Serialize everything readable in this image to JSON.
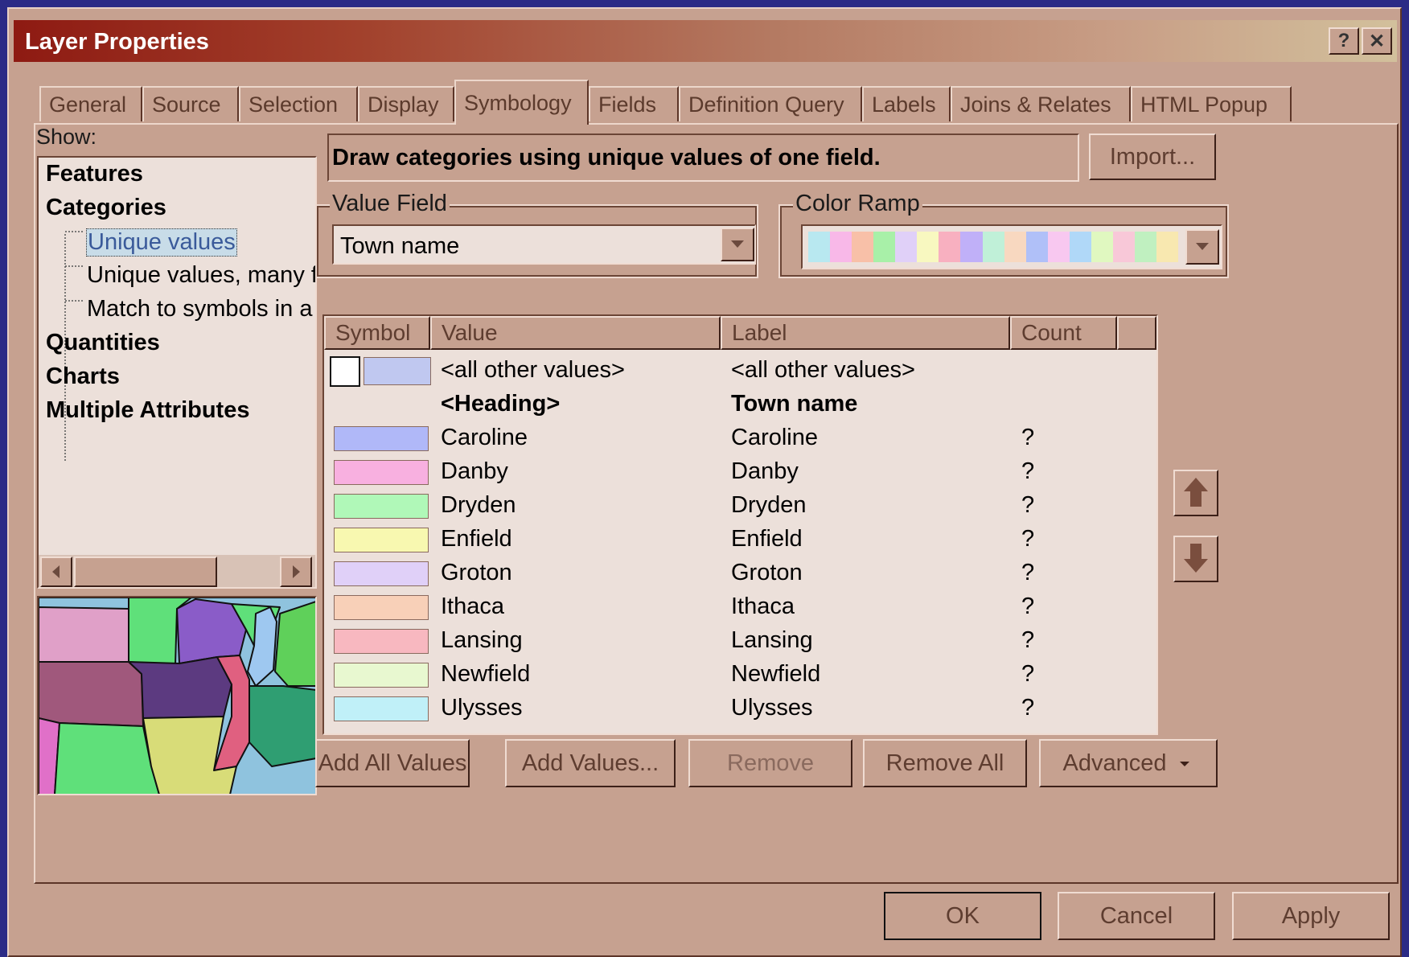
{
  "window": {
    "title": "Layer Properties",
    "help_label": "?",
    "close_label": "✕"
  },
  "tabs": [
    {
      "label": "General"
    },
    {
      "label": "Source"
    },
    {
      "label": "Selection"
    },
    {
      "label": "Display"
    },
    {
      "label": "Symbology",
      "active": true
    },
    {
      "label": "Fields"
    },
    {
      "label": "Definition Query"
    },
    {
      "label": "Labels"
    },
    {
      "label": "Joins & Relates"
    },
    {
      "label": "HTML Popup"
    }
  ],
  "show": {
    "label": "Show:",
    "items": [
      {
        "label": "Features"
      },
      {
        "label": "Categories"
      },
      {
        "label": "Unique values",
        "selected": true
      },
      {
        "label": "Unique values, many fields"
      },
      {
        "label": "Match to symbols in a style"
      },
      {
        "label": "Quantities"
      },
      {
        "label": "Charts"
      },
      {
        "label": "Multiple Attributes"
      }
    ]
  },
  "description": "Draw categories using unique values of one field.",
  "import_label": "Import...",
  "value_field": {
    "label": "Value Field",
    "value": "Town name"
  },
  "color_ramp": {
    "label": "Color Ramp",
    "colors": [
      "#b8e8f0",
      "#f8b8e8",
      "#f8c0a8",
      "#a8f0a8",
      "#e0d0f8",
      "#f8f8c0",
      "#f8b0c0",
      "#c0b0f8",
      "#c0f0d8",
      "#f8d8c0",
      "#b0c0f8",
      "#f8c8f0",
      "#b0d8f8",
      "#e0f8c0",
      "#f8c8d8",
      "#c0f0c0",
      "#f8e8b0"
    ]
  },
  "table": {
    "headers": [
      "Symbol",
      "Value",
      "Label",
      "Count"
    ],
    "rows": [
      {
        "value": "<all other values>",
        "label": "<all other values>",
        "count": "",
        "color": "#c0c8f0",
        "kind": "other"
      },
      {
        "value": "<Heading>",
        "label": "Town name",
        "count": "",
        "kind": "heading"
      },
      {
        "value": "Caroline",
        "label": "Caroline",
        "count": "?",
        "color": "#b0b8f8"
      },
      {
        "value": "Danby",
        "label": "Danby",
        "count": "?",
        "color": "#f8b0e0"
      },
      {
        "value": "Dryden",
        "label": "Dryden",
        "count": "?",
        "color": "#b0f8b8"
      },
      {
        "value": "Enfield",
        "label": "Enfield",
        "count": "?",
        "color": "#f8f8b0"
      },
      {
        "value": "Groton",
        "label": "Groton",
        "count": "?",
        "color": "#e0d0f8"
      },
      {
        "value": "Ithaca",
        "label": "Ithaca",
        "count": "?",
        "color": "#f8d0b8"
      },
      {
        "value": "Lansing",
        "label": "Lansing",
        "count": "?",
        "color": "#f8b8c0"
      },
      {
        "value": "Newfield",
        "label": "Newfield",
        "count": "?",
        "color": "#e8f8d0"
      },
      {
        "value": "Ulysses",
        "label": "Ulysses",
        "count": "?",
        "color": "#c0f0f8"
      }
    ]
  },
  "actions": {
    "add_all": "Add All Values",
    "add_values": "Add Values...",
    "remove": "Remove",
    "remove_all": "Remove All",
    "advanced": "Advanced"
  },
  "footer": {
    "ok": "OK",
    "cancel": "Cancel",
    "apply": "Apply"
  }
}
